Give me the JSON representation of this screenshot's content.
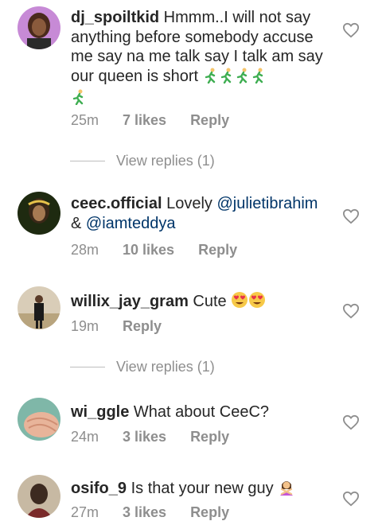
{
  "comments": [
    {
      "username": "dj_spoiltkid",
      "text": " Hmmm..I will not say anything before somebody accuse me say na me talk say I talk am say our queen is short",
      "emojis": [
        "runner-emoji",
        "runner-emoji",
        "runner-emoji",
        "runner-emoji",
        "runner-emoji"
      ],
      "time": "25m",
      "likes": "7 likes",
      "reply": "Reply",
      "view_replies": "View replies (1)"
    },
    {
      "username": "ceec.official",
      "text_before": " Lovely ",
      "mention1": "@julietibrahim",
      "text_mid": " & ",
      "mention2": "@iamteddya",
      "time": "28m",
      "likes": "10 likes",
      "reply": "Reply"
    },
    {
      "username": "willix_jay_gram",
      "text": " Cute",
      "emojis": [
        "heart-eyes-emoji",
        "heart-eyes-emoji"
      ],
      "time": "19m",
      "reply": "Reply",
      "view_replies": "View replies (1)"
    },
    {
      "username": "wi_ggle",
      "text": " What about CeeC?",
      "time": "24m",
      "likes": "3 likes",
      "reply": "Reply"
    },
    {
      "username": "osifo_9",
      "text": " Is that your new guy",
      "emojis": [
        "person-gesturing-no-emoji"
      ],
      "time": "27m",
      "likes": "3 likes",
      "reply": "Reply"
    }
  ],
  "colors": {
    "text": "#262626",
    "meta": "#8e8e8e",
    "mention": "#003569"
  }
}
